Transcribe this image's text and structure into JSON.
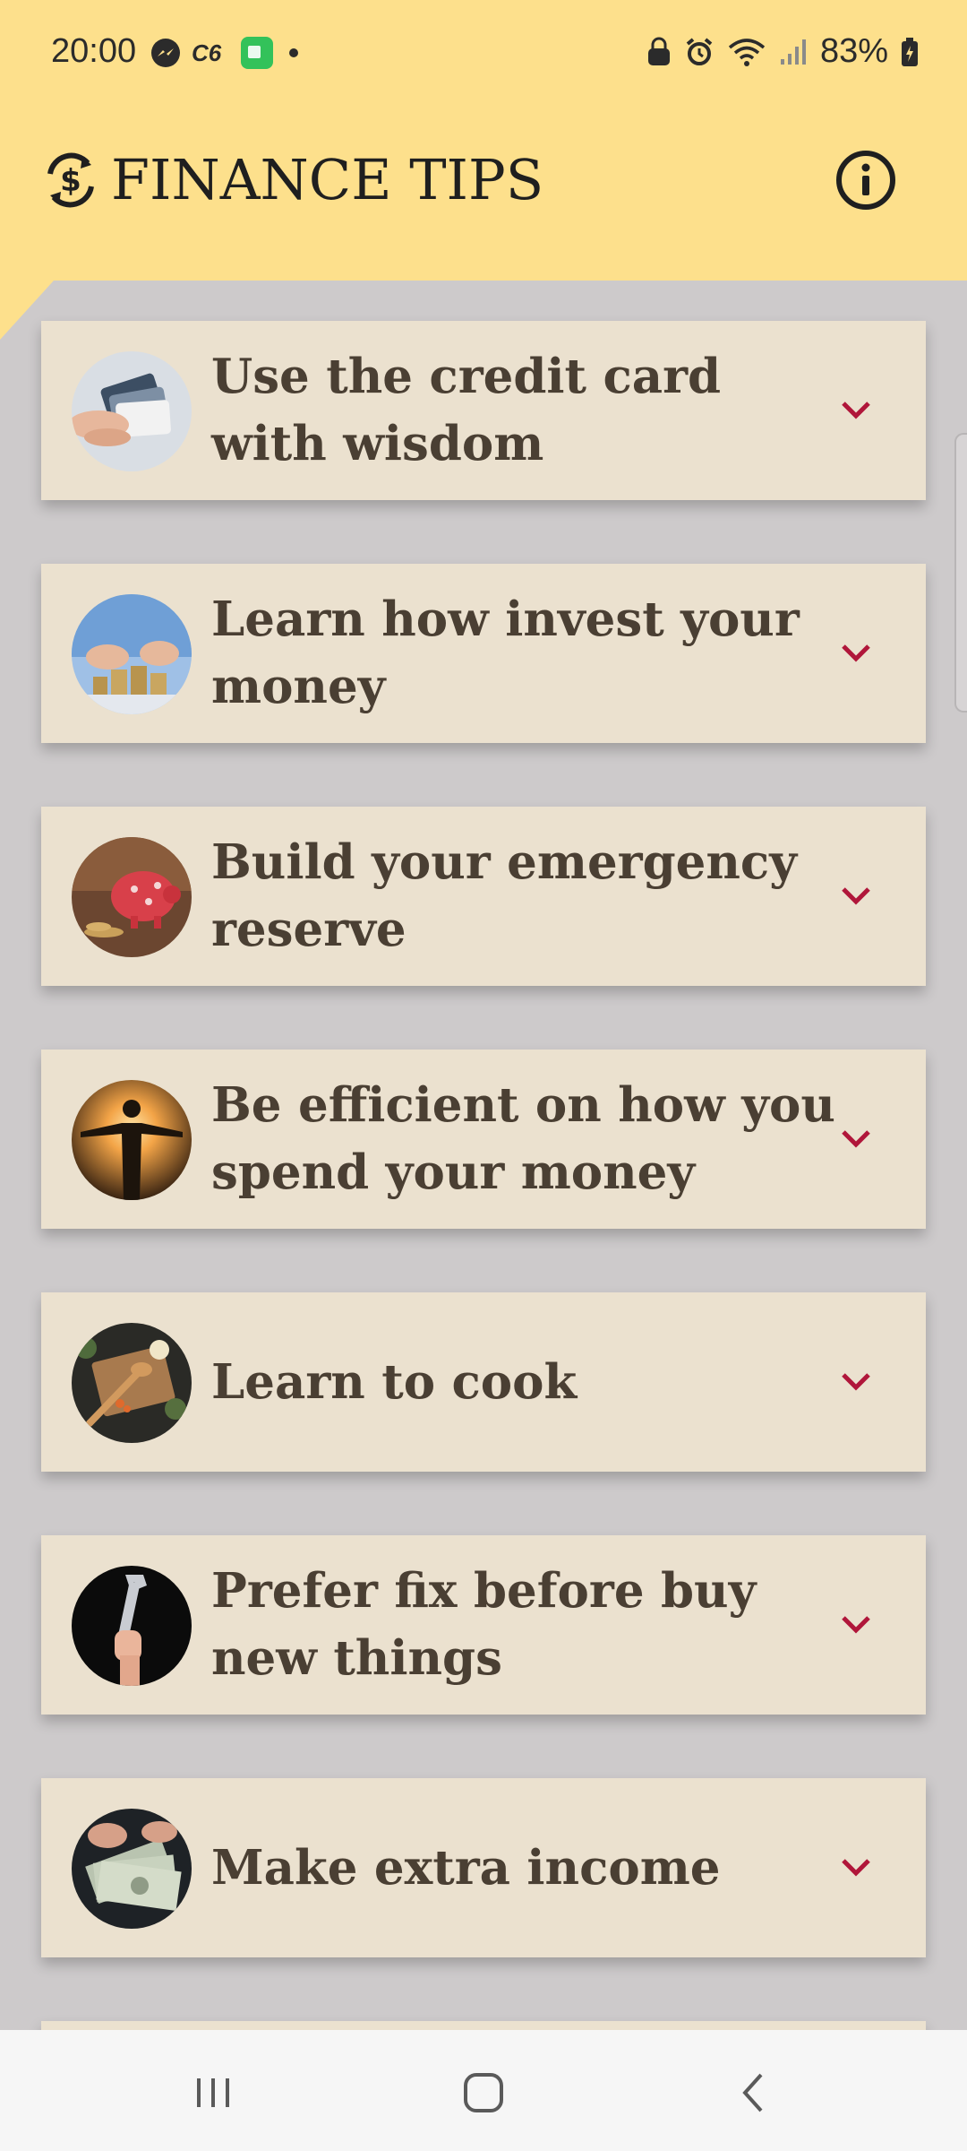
{
  "status_bar": {
    "time": "20:00",
    "battery": "83%",
    "left_icons": [
      "messenger-icon",
      "c6-icon",
      "picpay-icon",
      "dot-icon"
    ],
    "right_icons": [
      "lock-icon",
      "alarm-icon",
      "wifi-icon",
      "signal-icon",
      "battery-icon"
    ]
  },
  "app_bar": {
    "title": "FINANCE TIPS",
    "logo_icon": "dollar-cycle-icon",
    "info_icon": "info-icon"
  },
  "tips": [
    {
      "title": "Use the credit card with wisdom",
      "image": "credit-cards-photo"
    },
    {
      "title": "Learn how invest your money",
      "image": "coin-stacks-photo"
    },
    {
      "title": "Build your emergency reserve",
      "image": "piggy-bank-photo"
    },
    {
      "title": "Be efficient on how you spend your money",
      "image": "sunset-person-photo"
    },
    {
      "title": "Learn to cook",
      "image": "cooking-photo"
    },
    {
      "title": "Prefer fix before buy new things",
      "image": "wrench-hand-photo"
    },
    {
      "title": "Make extra income",
      "image": "dollar-bills-photo"
    }
  ],
  "colors": {
    "app_bar_bg": "#fde08c",
    "content_bg": "#cdcacb",
    "card_bg": "#ebe1cf",
    "card_text": "#4a3f33",
    "chevron": "#b0163a"
  },
  "nav_bar": {
    "icons": [
      "recent-apps-icon",
      "home-icon",
      "back-icon"
    ]
  }
}
